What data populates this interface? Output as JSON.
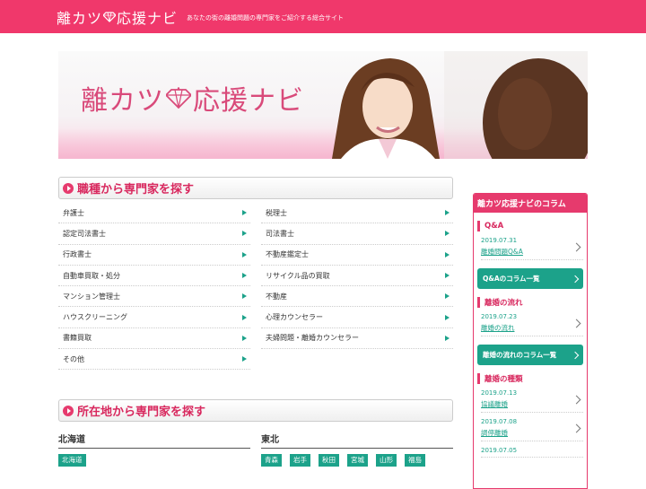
{
  "header": {
    "logo_text_1": "離カツ",
    "logo_text_2": "応援ナビ",
    "tagline": "あなたの街の離婚問題の専門家をご紹介する総合サイト"
  },
  "hero": {
    "title_1": "離カツ",
    "title_2": "応援ナビ"
  },
  "section_profession": {
    "title": "職種から専門家を探す",
    "left": [
      "弁護士",
      "認定司法書士",
      "行政書士",
      "自動車買取・処分",
      "マンション管理士",
      "ハウスクリーニング",
      "書籍買取",
      "その他"
    ],
    "right": [
      "税理士",
      "司法書士",
      "不動産鑑定士",
      "リサイクル品の買取",
      "不動産",
      "心理カウンセラー",
      "夫婦問題・離婚カウンセラー"
    ]
  },
  "section_location": {
    "title": "所在地から専門家を探す",
    "regions": [
      {
        "name": "北海道",
        "prefs": [
          "北海道"
        ]
      },
      {
        "name": "東北",
        "prefs": [
          "青森",
          "岩手",
          "秋田",
          "宮城",
          "山形",
          "福島"
        ]
      }
    ]
  },
  "sidebar": {
    "title": "離カツ応援ナビのコラム",
    "sections": [
      {
        "name": "Q&A",
        "posts": [
          {
            "date": "2019.07.31",
            "title": "離婚問題Q&A"
          }
        ],
        "more": "Q&Aのコラム一覧"
      },
      {
        "name": "離婚の流れ",
        "posts": [
          {
            "date": "2019.07.23",
            "title": "離婚の流れ"
          }
        ],
        "more": "離婚の流れのコラム一覧"
      },
      {
        "name": "離婚の種類",
        "posts": [
          {
            "date": "2019.07.13",
            "title": "協議離婚"
          },
          {
            "date": "2019.07.08",
            "title": "調停離婚"
          },
          {
            "date": "2019.07.05",
            "title": ""
          }
        ],
        "more": ""
      }
    ]
  },
  "colors": {
    "accent": "#f0386b",
    "green": "#1ca28a"
  }
}
